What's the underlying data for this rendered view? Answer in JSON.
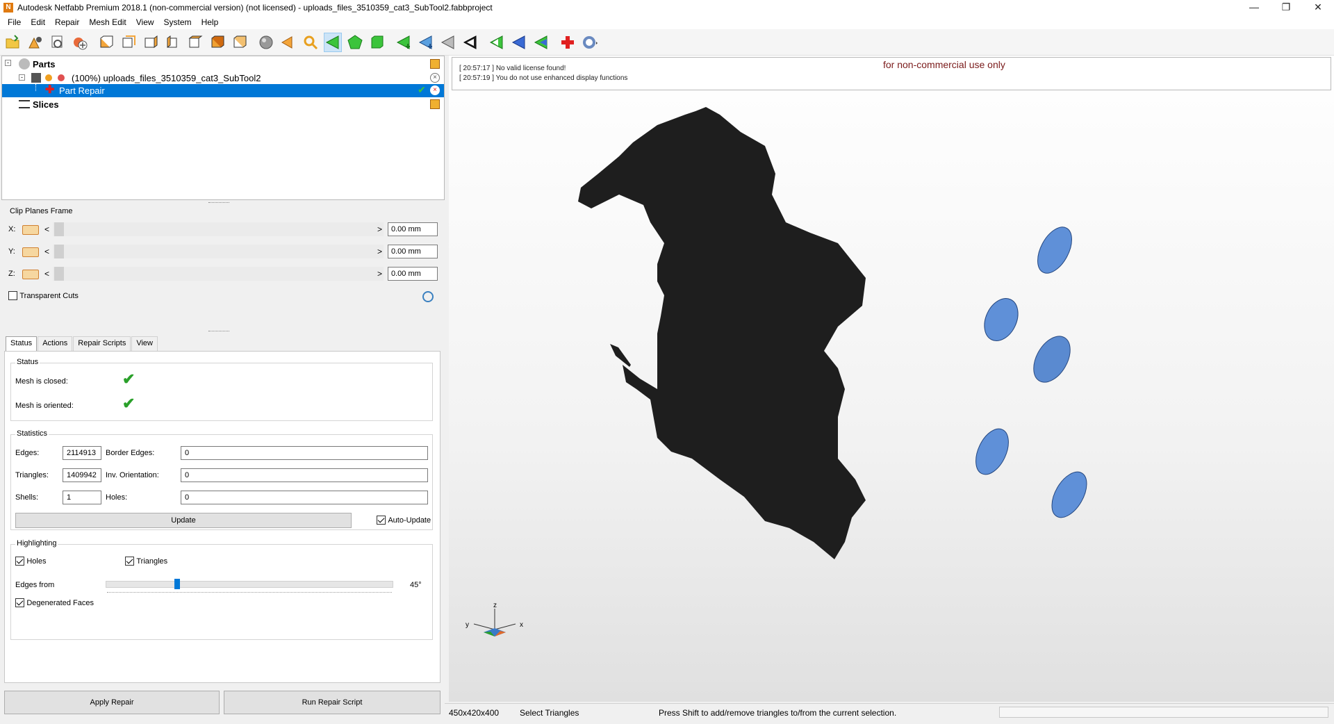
{
  "window": {
    "app_icon": "N",
    "title": "Autodesk Netfabb Premium 2018.1 (non-commercial version) (not licensed) - uploads_files_3510359_cat3_SubTool2.fabbproject"
  },
  "menu": [
    "File",
    "Edit",
    "Repair",
    "Mesh Edit",
    "View",
    "System",
    "Help"
  ],
  "toolbar_icons": [
    "open-project-icon",
    "add-part-icon",
    "import-icon",
    "add-icon",
    "view-front-icon",
    "view-back-icon",
    "view-left-icon",
    "view-right-icon",
    "view-top-icon",
    "view-bottom-icon",
    "view-iso-icon",
    "sphere-icon",
    "pan-arrow-icon",
    "zoom-icon",
    "select-triangles-icon",
    "select-surface-icon",
    "select-shell-icon",
    "select-inside-icon",
    "select-outside-icon",
    "select-brush-icon",
    "select-all-icon",
    "back-icon",
    "forward-icon",
    "invert-icon",
    "repair-cross-icon",
    "help-icon"
  ],
  "tree": {
    "parts": "Parts",
    "part_name": "(100%) uploads_files_3510359_cat3_SubTool2",
    "repair": "Part Repair",
    "slices": "Slices"
  },
  "clip": {
    "title": "Clip Planes Frame",
    "rows": [
      {
        "axis": "X:",
        "value": "0.00 mm"
      },
      {
        "axis": "Y:",
        "value": "0.00 mm"
      },
      {
        "axis": "Z:",
        "value": "0.00 mm"
      }
    ],
    "lt": "<",
    "gt": ">",
    "transparent": "Transparent Cuts"
  },
  "tabs": [
    "Status",
    "Actions",
    "Repair Scripts",
    "View"
  ],
  "status": {
    "title": "Status",
    "closed": "Mesh is closed:",
    "oriented": "Mesh is oriented:"
  },
  "stats": {
    "title": "Statistics",
    "edges_l": "Edges:",
    "edges": "2114913",
    "border_l": "Border Edges:",
    "border": "0",
    "tri_l": "Triangles:",
    "tri": "1409942",
    "inv_l": "Inv. Orientation:",
    "inv": "0",
    "shells_l": "Shells:",
    "shells": "1",
    "holes_l": "Holes:",
    "holes": "0",
    "update": "Update",
    "auto": "Auto-Update"
  },
  "highlight": {
    "title": "Highlighting",
    "holes": "Holes",
    "triangles": "Triangles",
    "edges_from": "Edges from",
    "angle": "45°",
    "angle_value": 45,
    "degen": "Degenerated Faces"
  },
  "buttons": {
    "apply": "Apply Repair",
    "run": "Run Repair Script"
  },
  "log": {
    "lines": [
      "[ 20:57:17 ] No valid license found!",
      "[ 20:57:19 ] You do not use enhanced display functions"
    ],
    "notice": "for non-commercial use only"
  },
  "axes": {
    "z": "z",
    "y": "y",
    "x": "x"
  },
  "statusbar": {
    "size": "450x420x400",
    "mode": "Select Triangles",
    "hint": "Press Shift to add/remove triangles to/from the current selection."
  }
}
